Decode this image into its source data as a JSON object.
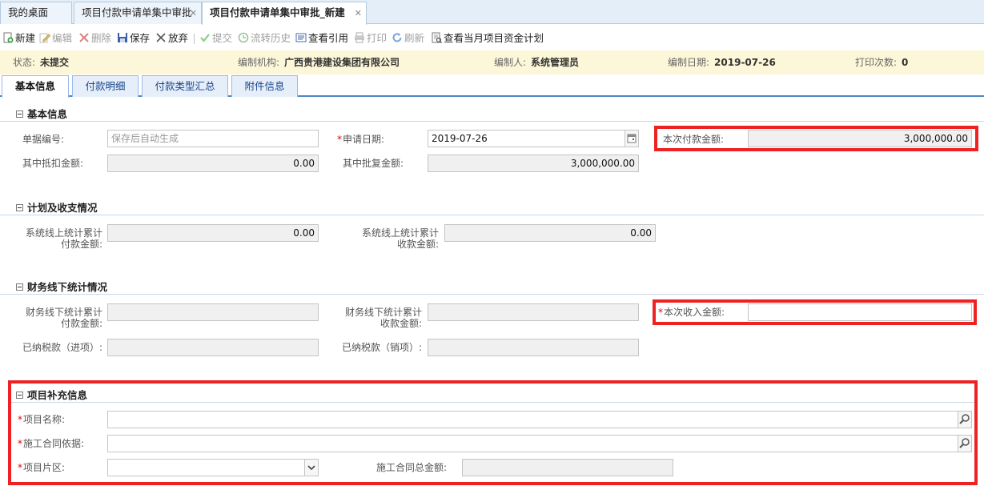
{
  "tabs": [
    {
      "label": "我的桌面",
      "closable": false
    },
    {
      "label": "项目付款申请单集中审批",
      "closable": true
    },
    {
      "label": "项目付款申请单集中审批_新建",
      "closable": true
    }
  ],
  "toolbar": {
    "new": "新建",
    "edit": "编辑",
    "delete": "删除",
    "save": "保存",
    "discard": "放弃",
    "submit": "提交",
    "history": "流转历史",
    "view_ref": "查看引用",
    "print": "打印",
    "refresh": "刷新",
    "monthly_plan": "查看当月项目资金计划"
  },
  "status_bar": {
    "status_label": "状态:",
    "status": "未提交",
    "org_label": "编制机构:",
    "org": "广西贵港建设集团有限公司",
    "author_label": "编制人:",
    "author": "系统管理员",
    "date_label": "编制日期:",
    "date": "2019-07-26",
    "print_label": "打印次数:",
    "print_count": "0"
  },
  "form_tabs": [
    "基本信息",
    "付款明细",
    "付款类型汇总",
    "附件信息"
  ],
  "basic": {
    "title": "基本信息",
    "doc_no_label": "单据编号:",
    "doc_no": "保存后自动生成",
    "apply_date_label": "申请日期:",
    "apply_date": "2019-07-26",
    "pay_amount_label": "本次付款金额:",
    "pay_amount": "3,000,000.00",
    "deduct_label": "其中抵扣金额:",
    "deduct": "0.00",
    "approved_label": "其中批复金额:",
    "approved": "3,000,000.00"
  },
  "plan": {
    "title": "计划及收支情况",
    "online_pay_label": "系统线上统计累计付款金额:",
    "online_pay": "0.00",
    "online_recv_label": "系统线上统计累计收款金额:",
    "online_recv": "0.00"
  },
  "finance": {
    "title": "财务线下统计情况",
    "offline_pay_label": "财务线下统计累计付款金额:",
    "offline_pay": "",
    "offline_recv_label": "财务线下统计累计收款金额:",
    "offline_recv": "",
    "income_label": "本次收入金额:",
    "income": "",
    "tax_in_label": "已纳税款（进项）:",
    "tax_in": "",
    "tax_out_label": "已纳税款（销项）:",
    "tax_out": ""
  },
  "project": {
    "title": "项目补充信息",
    "name_label": "项目名称:",
    "name": "",
    "contract_label": "施工合同依据:",
    "contract": "",
    "area_label": "项目片区:",
    "area": "",
    "contract_total_label": "施工合同总金额:",
    "contract_total": ""
  },
  "colors": {
    "highlight": "#ee2222",
    "status_bg": "#fdf7d9",
    "tab_accent": "#4d86c4",
    "required": "#e00000"
  }
}
